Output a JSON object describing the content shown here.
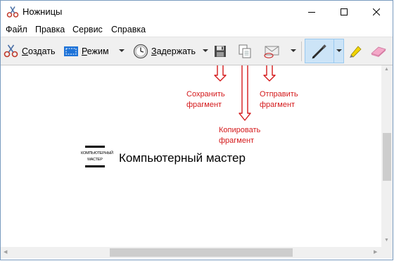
{
  "window": {
    "title": "Ножницы"
  },
  "menu": [
    "Файл",
    "Правка",
    "Сервис",
    "Справка"
  ],
  "toolbar": {
    "create_label": "Создать",
    "create_underline": "С",
    "create_rest": "оздать",
    "mode_underline": "Р",
    "mode_rest": "ежим",
    "delay_underline": "З",
    "delay_rest": "адержать"
  },
  "annotations": {
    "save": [
      "Сохранить",
      "фрагмент"
    ],
    "copy": [
      "Копировать",
      "фрагмент"
    ],
    "send": [
      "Отправить",
      "фрагмент"
    ]
  },
  "brand": {
    "logo_line1": "КОМПЬЮТЕРНЫЙ",
    "logo_line2": "МАСТЕР",
    "name": "Компьютерный мастер"
  },
  "colors": {
    "annotation": "#d4191b",
    "active_tool": "#cce4f7"
  },
  "icons": [
    "scissors-icon",
    "rectangle-mode-icon",
    "clock-icon",
    "save-icon",
    "copy-icon",
    "send-email-icon",
    "pen-icon",
    "highlighter-icon",
    "eraser-icon"
  ]
}
